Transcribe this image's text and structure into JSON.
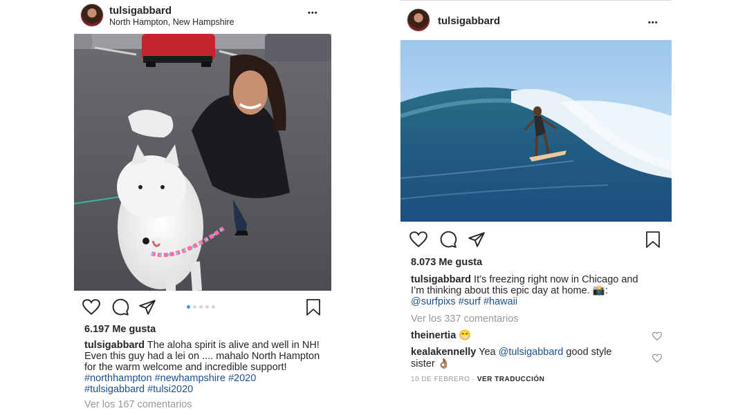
{
  "post_left": {
    "username": "tulsigabbard",
    "location": "North Hampton, New Hampshire",
    "more_label": "•••",
    "likes": "6.197 Me gusta",
    "caption_user": "tulsigabbard",
    "caption_line1": "The aloha spirit is alive and well in NH!",
    "caption_line2": "Even this guy had a lei on .... mahalo North Hampton",
    "caption_line3": "for the warm welcome and incredible support!",
    "hashtags_line1": "#northhampton #newhampshire #2020",
    "hashtags_line2": "#tulsigabbard #tulsi2020",
    "view_comments": "Ver los 167 comentarios",
    "carousel_count": 5,
    "carousel_active": 1
  },
  "post_right": {
    "username": "tulsigabbard",
    "more_label": "•••",
    "likes": "8.073 Me gusta",
    "caption_user": "tulsigabbard",
    "caption_line1": "It’s freezing right now in Chicago and",
    "caption_line2": "I’m thinking about this epic day at home.",
    "caption_emoji": "📸:",
    "hashtags": "@surfpixs #surf #hawaii",
    "view_comments": "Ver los 337 comentarios",
    "comments": [
      {
        "user": "theinertia",
        "text": "😁"
      },
      {
        "user": "kealakennelly",
        "text_pre": "Yea",
        "mention": "@tulsigabbard",
        "text_post": "good style",
        "line2": "sister 👌🏽"
      }
    ],
    "date": "10 DE FEBRERO",
    "separator": "·",
    "translate": "VER TRADUCCIÓN"
  },
  "colors": {
    "link": "#1d4f8c",
    "muted": "#999999",
    "active_dot": "#3897f0"
  },
  "icons": [
    "heart-icon",
    "comment-icon",
    "share-icon",
    "bookmark-icon",
    "more-icon"
  ]
}
